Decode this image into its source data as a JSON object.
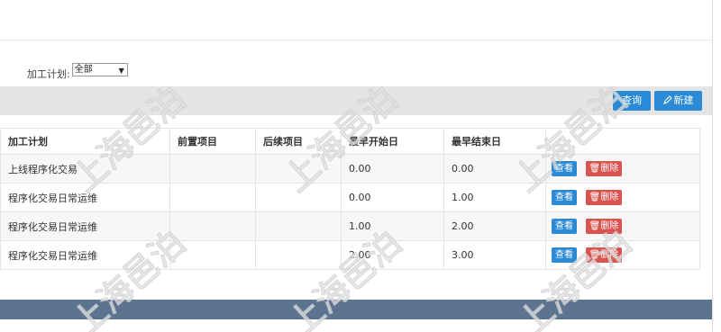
{
  "filter": {
    "label": "加工计划:",
    "select_value": "全部"
  },
  "toolbar": {
    "query_label": "查询",
    "new_label": "新建",
    "new_icon": "pencil-icon"
  },
  "table": {
    "headers": [
      "加工计划",
      "前置项目",
      "后续项目",
      "最早开始日",
      "最早结束日",
      ""
    ],
    "rows": [
      {
        "plan": "上线程序化交易",
        "pre": "",
        "next": "",
        "start": "0.00",
        "end": "0.00"
      },
      {
        "plan": "程序化交易日常运维",
        "pre": "",
        "next": "",
        "start": "0.00",
        "end": "1.00"
      },
      {
        "plan": "程序化交易日常运维",
        "pre": "",
        "next": "",
        "start": "1.00",
        "end": "2.00"
      },
      {
        "plan": "程序化交易日常运维",
        "pre": "",
        "next": "",
        "start": "2.00",
        "end": "3.00"
      }
    ],
    "view_label": "查看",
    "delete_label": "删除",
    "delete_icon": "trash-icon"
  },
  "watermark": {
    "text": "上海邑泊"
  },
  "colors": {
    "primary": "#2a8ad5",
    "danger": "#d9534f",
    "toolbar_bg": "#e4e4e4",
    "footer_bg": "#5d7491"
  }
}
